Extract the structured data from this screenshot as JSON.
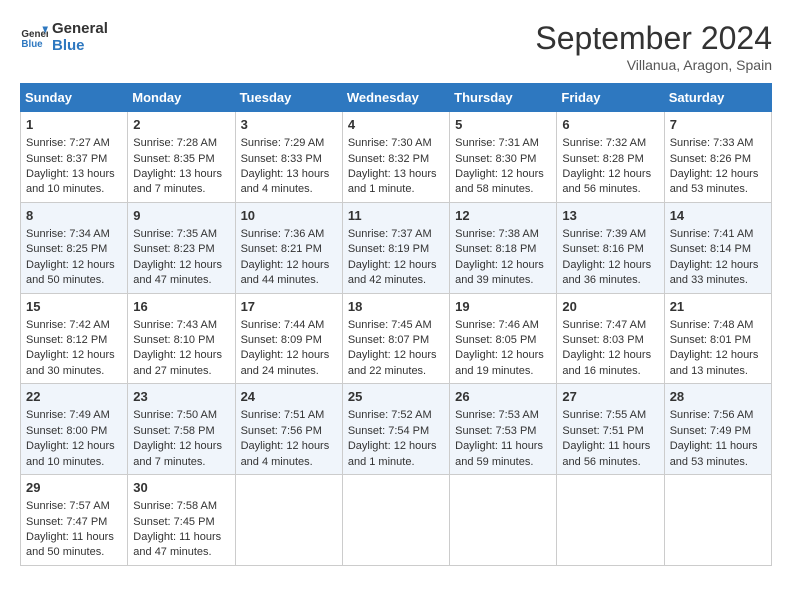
{
  "header": {
    "logo_line1": "General",
    "logo_line2": "Blue",
    "month": "September 2024",
    "location": "Villanua, Aragon, Spain"
  },
  "weekdays": [
    "Sunday",
    "Monday",
    "Tuesday",
    "Wednesday",
    "Thursday",
    "Friday",
    "Saturday"
  ],
  "weeks": [
    [
      {
        "day": "1",
        "sunrise": "Sunrise: 7:27 AM",
        "sunset": "Sunset: 8:37 PM",
        "daylight": "Daylight: 13 hours and 10 minutes."
      },
      {
        "day": "2",
        "sunrise": "Sunrise: 7:28 AM",
        "sunset": "Sunset: 8:35 PM",
        "daylight": "Daylight: 13 hours and 7 minutes."
      },
      {
        "day": "3",
        "sunrise": "Sunrise: 7:29 AM",
        "sunset": "Sunset: 8:33 PM",
        "daylight": "Daylight: 13 hours and 4 minutes."
      },
      {
        "day": "4",
        "sunrise": "Sunrise: 7:30 AM",
        "sunset": "Sunset: 8:32 PM",
        "daylight": "Daylight: 13 hours and 1 minute."
      },
      {
        "day": "5",
        "sunrise": "Sunrise: 7:31 AM",
        "sunset": "Sunset: 8:30 PM",
        "daylight": "Daylight: 12 hours and 58 minutes."
      },
      {
        "day": "6",
        "sunrise": "Sunrise: 7:32 AM",
        "sunset": "Sunset: 8:28 PM",
        "daylight": "Daylight: 12 hours and 56 minutes."
      },
      {
        "day": "7",
        "sunrise": "Sunrise: 7:33 AM",
        "sunset": "Sunset: 8:26 PM",
        "daylight": "Daylight: 12 hours and 53 minutes."
      }
    ],
    [
      {
        "day": "8",
        "sunrise": "Sunrise: 7:34 AM",
        "sunset": "Sunset: 8:25 PM",
        "daylight": "Daylight: 12 hours and 50 minutes."
      },
      {
        "day": "9",
        "sunrise": "Sunrise: 7:35 AM",
        "sunset": "Sunset: 8:23 PM",
        "daylight": "Daylight: 12 hours and 47 minutes."
      },
      {
        "day": "10",
        "sunrise": "Sunrise: 7:36 AM",
        "sunset": "Sunset: 8:21 PM",
        "daylight": "Daylight: 12 hours and 44 minutes."
      },
      {
        "day": "11",
        "sunrise": "Sunrise: 7:37 AM",
        "sunset": "Sunset: 8:19 PM",
        "daylight": "Daylight: 12 hours and 42 minutes."
      },
      {
        "day": "12",
        "sunrise": "Sunrise: 7:38 AM",
        "sunset": "Sunset: 8:18 PM",
        "daylight": "Daylight: 12 hours and 39 minutes."
      },
      {
        "day": "13",
        "sunrise": "Sunrise: 7:39 AM",
        "sunset": "Sunset: 8:16 PM",
        "daylight": "Daylight: 12 hours and 36 minutes."
      },
      {
        "day": "14",
        "sunrise": "Sunrise: 7:41 AM",
        "sunset": "Sunset: 8:14 PM",
        "daylight": "Daylight: 12 hours and 33 minutes."
      }
    ],
    [
      {
        "day": "15",
        "sunrise": "Sunrise: 7:42 AM",
        "sunset": "Sunset: 8:12 PM",
        "daylight": "Daylight: 12 hours and 30 minutes."
      },
      {
        "day": "16",
        "sunrise": "Sunrise: 7:43 AM",
        "sunset": "Sunset: 8:10 PM",
        "daylight": "Daylight: 12 hours and 27 minutes."
      },
      {
        "day": "17",
        "sunrise": "Sunrise: 7:44 AM",
        "sunset": "Sunset: 8:09 PM",
        "daylight": "Daylight: 12 hours and 24 minutes."
      },
      {
        "day": "18",
        "sunrise": "Sunrise: 7:45 AM",
        "sunset": "Sunset: 8:07 PM",
        "daylight": "Daylight: 12 hours and 22 minutes."
      },
      {
        "day": "19",
        "sunrise": "Sunrise: 7:46 AM",
        "sunset": "Sunset: 8:05 PM",
        "daylight": "Daylight: 12 hours and 19 minutes."
      },
      {
        "day": "20",
        "sunrise": "Sunrise: 7:47 AM",
        "sunset": "Sunset: 8:03 PM",
        "daylight": "Daylight: 12 hours and 16 minutes."
      },
      {
        "day": "21",
        "sunrise": "Sunrise: 7:48 AM",
        "sunset": "Sunset: 8:01 PM",
        "daylight": "Daylight: 12 hours and 13 minutes."
      }
    ],
    [
      {
        "day": "22",
        "sunrise": "Sunrise: 7:49 AM",
        "sunset": "Sunset: 8:00 PM",
        "daylight": "Daylight: 12 hours and 10 minutes."
      },
      {
        "day": "23",
        "sunrise": "Sunrise: 7:50 AM",
        "sunset": "Sunset: 7:58 PM",
        "daylight": "Daylight: 12 hours and 7 minutes."
      },
      {
        "day": "24",
        "sunrise": "Sunrise: 7:51 AM",
        "sunset": "Sunset: 7:56 PM",
        "daylight": "Daylight: 12 hours and 4 minutes."
      },
      {
        "day": "25",
        "sunrise": "Sunrise: 7:52 AM",
        "sunset": "Sunset: 7:54 PM",
        "daylight": "Daylight: 12 hours and 1 minute."
      },
      {
        "day": "26",
        "sunrise": "Sunrise: 7:53 AM",
        "sunset": "Sunset: 7:53 PM",
        "daylight": "Daylight: 11 hours and 59 minutes."
      },
      {
        "day": "27",
        "sunrise": "Sunrise: 7:55 AM",
        "sunset": "Sunset: 7:51 PM",
        "daylight": "Daylight: 11 hours and 56 minutes."
      },
      {
        "day": "28",
        "sunrise": "Sunrise: 7:56 AM",
        "sunset": "Sunset: 7:49 PM",
        "daylight": "Daylight: 11 hours and 53 minutes."
      }
    ],
    [
      {
        "day": "29",
        "sunrise": "Sunrise: 7:57 AM",
        "sunset": "Sunset: 7:47 PM",
        "daylight": "Daylight: 11 hours and 50 minutes."
      },
      {
        "day": "30",
        "sunrise": "Sunrise: 7:58 AM",
        "sunset": "Sunset: 7:45 PM",
        "daylight": "Daylight: 11 hours and 47 minutes."
      },
      null,
      null,
      null,
      null,
      null
    ]
  ]
}
